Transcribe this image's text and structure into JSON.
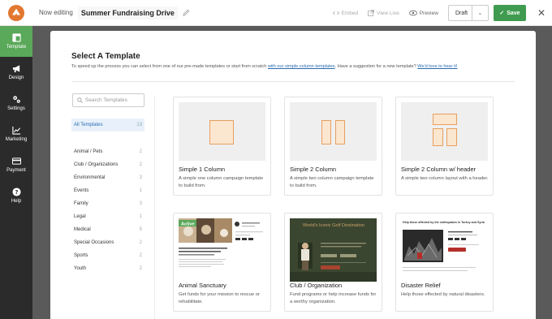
{
  "topbar": {
    "now_editing": "Now editing",
    "campaign_name": "Summer Fundraising Drive",
    "embed": "Embed",
    "view_live": "View Live",
    "preview": "Preview",
    "status_value": "Draft",
    "save": "Save"
  },
  "sidebar": {
    "items": [
      {
        "label": "Template",
        "icon": "template-icon",
        "active": true
      },
      {
        "label": "Design",
        "icon": "megaphone-icon"
      },
      {
        "label": "Settings",
        "icon": "gears-icon"
      },
      {
        "label": "Marketing",
        "icon": "chart-icon"
      },
      {
        "label": "Payment",
        "icon": "credit-card-icon"
      },
      {
        "label": "Help",
        "icon": "help-icon"
      }
    ]
  },
  "modal": {
    "title": "Select A Template",
    "desc_prefix": "To speed up the process you can select from one of our pre-made templates or start from scratch ",
    "desc_link1": "with our simple column templates",
    "desc_mid": ". Have a suggestion for a new template? ",
    "desc_link2": "We'd love to hear it!",
    "search_placeholder": "Search Templates",
    "all_templates": {
      "label": "All Templates",
      "count": "13"
    },
    "categories": [
      {
        "label": "Animal / Pets",
        "count": "2"
      },
      {
        "label": "Club / Organizations",
        "count": "2"
      },
      {
        "label": "Environmental",
        "count": "3"
      },
      {
        "label": "Events",
        "count": "1"
      },
      {
        "label": "Family",
        "count": "3"
      },
      {
        "label": "Legal",
        "count": "1"
      },
      {
        "label": "Medical",
        "count": "5"
      },
      {
        "label": "Special Occasions",
        "count": "2"
      },
      {
        "label": "Sports",
        "count": "2"
      },
      {
        "label": "Youth",
        "count": "2"
      }
    ],
    "templates": [
      {
        "title": "Simple 1 Column",
        "desc": "A simple one column campaign template to build from."
      },
      {
        "title": "Simple 2 Column",
        "desc": "A simple two column campaign template to build from."
      },
      {
        "title": "Simple 2 Column w/ header",
        "desc": "A simple two column layout with a header."
      },
      {
        "title": "Animal Sanctuary",
        "desc": "Get funds for your mission to rescue or rehabilitate.",
        "badge": "Active"
      },
      {
        "title": "Club / Organization",
        "desc": "Fund programs or help increase funds for a worthy organization.",
        "thumb_title": "World's Iconic Golf Destination"
      },
      {
        "title": "Disaster Relief",
        "desc": "Help those effected by natural disasters.",
        "thumb_title": "Help those affected by the earthquakes in Turkey and Syria"
      }
    ]
  },
  "colors": {
    "accent_green": "#3f9b4f",
    "sidebar_active": "#5aa85a",
    "sidebar_bg": "#2b2b2b",
    "link_blue": "#2b6cb0",
    "placeholder_orange": "#e6a060"
  }
}
